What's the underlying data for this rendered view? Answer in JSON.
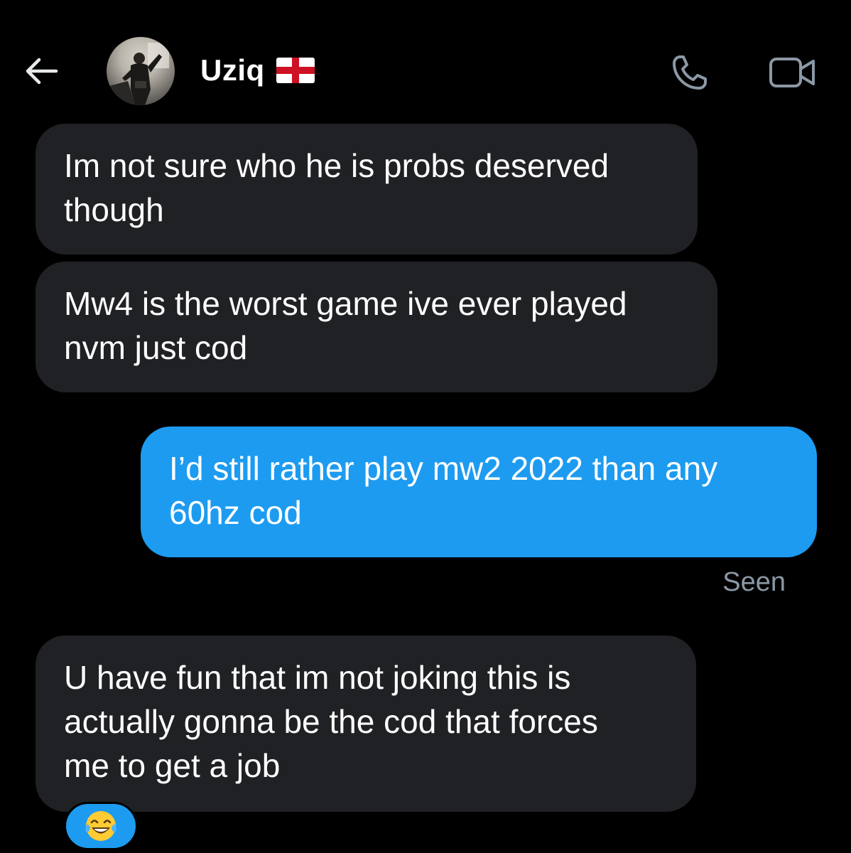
{
  "header": {
    "contact_name": "Uziq",
    "flag_icon": "england-flag-icon",
    "back_icon": "arrow-left-icon",
    "call_icon": "phone-icon",
    "video_icon": "video-camera-icon",
    "avatar_icon": "avatar-photo"
  },
  "messages": [
    {
      "direction": "received",
      "text": "Im not sure who he is probs deserved\nthough"
    },
    {
      "direction": "received",
      "text": "Mw4 is the worst game ive ever played\nnvm just cod"
    },
    {
      "direction": "sent",
      "text": "I’d still rather play mw2 2022 than any\n60hz cod"
    },
    {
      "direction": "received",
      "text": "U have fun that im not joking this is\nactually gonna be the cod that forces\nme to get a job"
    }
  ],
  "status": {
    "seen_label": "Seen"
  },
  "reaction": {
    "emoji_icon": "face-with-tears-of-joy-icon"
  },
  "colors": {
    "background": "#000000",
    "received_bubble": "#202124",
    "sent_bubble": "#1d9bf0",
    "seen_text": "#8b98a5"
  }
}
